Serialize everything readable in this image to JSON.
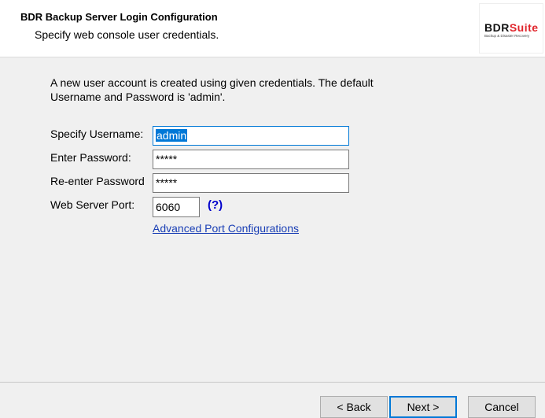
{
  "header": {
    "title": "BDR Backup Server Login Configuration",
    "subtitle": "Specify web console user credentials."
  },
  "logo": {
    "text_main": "BDR",
    "text_accent": "Suite",
    "tagline": "Backup & Disaster Recovery"
  },
  "form": {
    "info": "A new user account is created using given credentials. The default Username and Password is 'admin'.",
    "username_label": "Specify Username:",
    "username_value": "admin",
    "password_label": "Enter Password:",
    "password_value": "*****",
    "reenter_label": "Re-enter Password:",
    "reenter_value": "*****",
    "port_label": "Web Server Port:",
    "port_value": "6060",
    "help_label": "(?)",
    "advanced_link": "Advanced Port Configurations"
  },
  "buttons": {
    "back": "< Back",
    "next": "Next >",
    "cancel": "Cancel"
  },
  "colors": {
    "accent": "#0078d7",
    "logo_red": "#e0242b",
    "link": "#1a3fb5"
  }
}
